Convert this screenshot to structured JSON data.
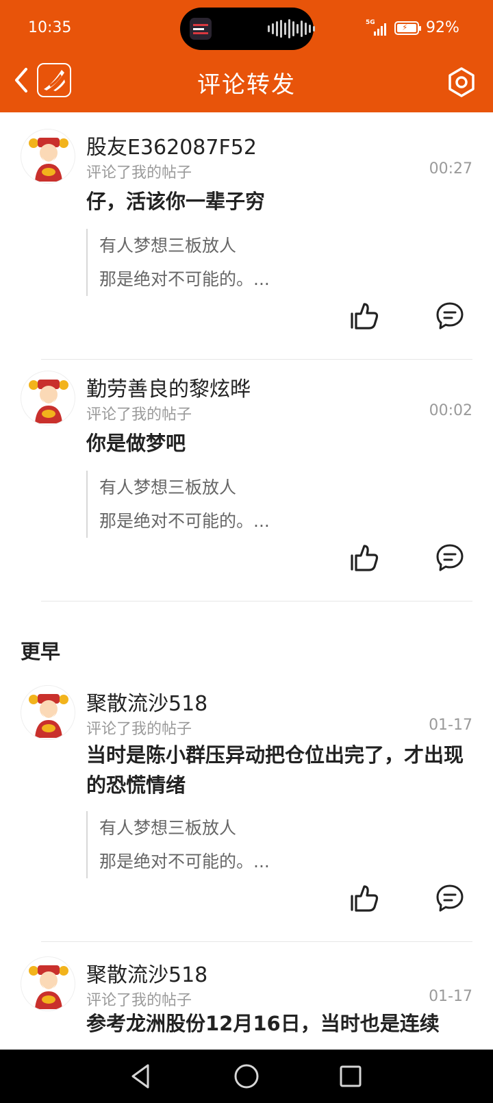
{
  "status": {
    "time": "10:35",
    "network": "5G",
    "battery": "92%",
    "battery_level": 0.92
  },
  "header": {
    "title": "评论转发",
    "back_icon": "chevron-left-icon",
    "settings_icon": "gear-icon"
  },
  "colors": {
    "brand": "#e8540a",
    "muted_text": "#9a9a9a"
  },
  "comments": [
    {
      "user": "股友E362087F52",
      "action": "评论了我的帖子",
      "time": "00:27",
      "text": "仔，活该你一辈子穷",
      "quote_line1": "有人梦想三板放人",
      "quote_line2": "那是绝对不可能的。..."
    },
    {
      "user": "勤劳善良的黎炫晔",
      "action": "评论了我的帖子",
      "time": "00:02",
      "text": "你是做梦吧",
      "quote_line1": "有人梦想三板放人",
      "quote_line2": "那是绝对不可能的。..."
    }
  ],
  "earlier": {
    "title": "更早",
    "comments": [
      {
        "user": "聚散流沙518",
        "action": "评论了我的帖子",
        "time": "01-17",
        "text": "当时是陈小群压异动把仓位出完了，才出现的恐慌情绪",
        "quote_line1": "有人梦想三板放人",
        "quote_line2": "那是绝对不可能的。..."
      },
      {
        "user": "聚散流沙518",
        "action": "评论了我的帖子",
        "time": "01-17",
        "text": "参考龙洲股份12月16日，当时也是连续"
      }
    ]
  }
}
